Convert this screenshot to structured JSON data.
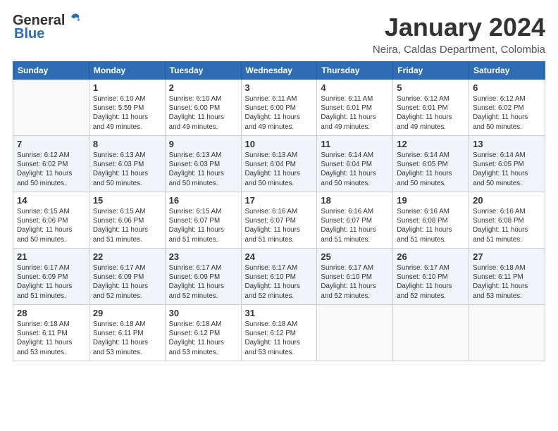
{
  "logo": {
    "general": "General",
    "blue": "Blue"
  },
  "title": "January 2024",
  "location": "Neira, Caldas Department, Colombia",
  "days_of_week": [
    "Sunday",
    "Monday",
    "Tuesday",
    "Wednesday",
    "Thursday",
    "Friday",
    "Saturday"
  ],
  "weeks": [
    [
      {
        "num": "",
        "sunrise": "",
        "sunset": "",
        "daylight": ""
      },
      {
        "num": "1",
        "sunrise": "Sunrise: 6:10 AM",
        "sunset": "Sunset: 5:59 PM",
        "daylight": "Daylight: 11 hours and 49 minutes."
      },
      {
        "num": "2",
        "sunrise": "Sunrise: 6:10 AM",
        "sunset": "Sunset: 6:00 PM",
        "daylight": "Daylight: 11 hours and 49 minutes."
      },
      {
        "num": "3",
        "sunrise": "Sunrise: 6:11 AM",
        "sunset": "Sunset: 6:00 PM",
        "daylight": "Daylight: 11 hours and 49 minutes."
      },
      {
        "num": "4",
        "sunrise": "Sunrise: 6:11 AM",
        "sunset": "Sunset: 6:01 PM",
        "daylight": "Daylight: 11 hours and 49 minutes."
      },
      {
        "num": "5",
        "sunrise": "Sunrise: 6:12 AM",
        "sunset": "Sunset: 6:01 PM",
        "daylight": "Daylight: 11 hours and 49 minutes."
      },
      {
        "num": "6",
        "sunrise": "Sunrise: 6:12 AM",
        "sunset": "Sunset: 6:02 PM",
        "daylight": "Daylight: 11 hours and 50 minutes."
      }
    ],
    [
      {
        "num": "7",
        "sunrise": "Sunrise: 6:12 AM",
        "sunset": "Sunset: 6:02 PM",
        "daylight": "Daylight: 11 hours and 50 minutes."
      },
      {
        "num": "8",
        "sunrise": "Sunrise: 6:13 AM",
        "sunset": "Sunset: 6:03 PM",
        "daylight": "Daylight: 11 hours and 50 minutes."
      },
      {
        "num": "9",
        "sunrise": "Sunrise: 6:13 AM",
        "sunset": "Sunset: 6:03 PM",
        "daylight": "Daylight: 11 hours and 50 minutes."
      },
      {
        "num": "10",
        "sunrise": "Sunrise: 6:13 AM",
        "sunset": "Sunset: 6:04 PM",
        "daylight": "Daylight: 11 hours and 50 minutes."
      },
      {
        "num": "11",
        "sunrise": "Sunrise: 6:14 AM",
        "sunset": "Sunset: 6:04 PM",
        "daylight": "Daylight: 11 hours and 50 minutes."
      },
      {
        "num": "12",
        "sunrise": "Sunrise: 6:14 AM",
        "sunset": "Sunset: 6:05 PM",
        "daylight": "Daylight: 11 hours and 50 minutes."
      },
      {
        "num": "13",
        "sunrise": "Sunrise: 6:14 AM",
        "sunset": "Sunset: 6:05 PM",
        "daylight": "Daylight: 11 hours and 50 minutes."
      }
    ],
    [
      {
        "num": "14",
        "sunrise": "Sunrise: 6:15 AM",
        "sunset": "Sunset: 6:06 PM",
        "daylight": "Daylight: 11 hours and 50 minutes."
      },
      {
        "num": "15",
        "sunrise": "Sunrise: 6:15 AM",
        "sunset": "Sunset: 6:06 PM",
        "daylight": "Daylight: 11 hours and 51 minutes."
      },
      {
        "num": "16",
        "sunrise": "Sunrise: 6:15 AM",
        "sunset": "Sunset: 6:07 PM",
        "daylight": "Daylight: 11 hours and 51 minutes."
      },
      {
        "num": "17",
        "sunrise": "Sunrise: 6:16 AM",
        "sunset": "Sunset: 6:07 PM",
        "daylight": "Daylight: 11 hours and 51 minutes."
      },
      {
        "num": "18",
        "sunrise": "Sunrise: 6:16 AM",
        "sunset": "Sunset: 6:07 PM",
        "daylight": "Daylight: 11 hours and 51 minutes."
      },
      {
        "num": "19",
        "sunrise": "Sunrise: 6:16 AM",
        "sunset": "Sunset: 6:08 PM",
        "daylight": "Daylight: 11 hours and 51 minutes."
      },
      {
        "num": "20",
        "sunrise": "Sunrise: 6:16 AM",
        "sunset": "Sunset: 6:08 PM",
        "daylight": "Daylight: 11 hours and 51 minutes."
      }
    ],
    [
      {
        "num": "21",
        "sunrise": "Sunrise: 6:17 AM",
        "sunset": "Sunset: 6:09 PM",
        "daylight": "Daylight: 11 hours and 51 minutes."
      },
      {
        "num": "22",
        "sunrise": "Sunrise: 6:17 AM",
        "sunset": "Sunset: 6:09 PM",
        "daylight": "Daylight: 11 hours and 52 minutes."
      },
      {
        "num": "23",
        "sunrise": "Sunrise: 6:17 AM",
        "sunset": "Sunset: 6:09 PM",
        "daylight": "Daylight: 11 hours and 52 minutes."
      },
      {
        "num": "24",
        "sunrise": "Sunrise: 6:17 AM",
        "sunset": "Sunset: 6:10 PM",
        "daylight": "Daylight: 11 hours and 52 minutes."
      },
      {
        "num": "25",
        "sunrise": "Sunrise: 6:17 AM",
        "sunset": "Sunset: 6:10 PM",
        "daylight": "Daylight: 11 hours and 52 minutes."
      },
      {
        "num": "26",
        "sunrise": "Sunrise: 6:17 AM",
        "sunset": "Sunset: 6:10 PM",
        "daylight": "Daylight: 11 hours and 52 minutes."
      },
      {
        "num": "27",
        "sunrise": "Sunrise: 6:18 AM",
        "sunset": "Sunset: 6:11 PM",
        "daylight": "Daylight: 11 hours and 53 minutes."
      }
    ],
    [
      {
        "num": "28",
        "sunrise": "Sunrise: 6:18 AM",
        "sunset": "Sunset: 6:11 PM",
        "daylight": "Daylight: 11 hours and 53 minutes."
      },
      {
        "num": "29",
        "sunrise": "Sunrise: 6:18 AM",
        "sunset": "Sunset: 6:11 PM",
        "daylight": "Daylight: 11 hours and 53 minutes."
      },
      {
        "num": "30",
        "sunrise": "Sunrise: 6:18 AM",
        "sunset": "Sunset: 6:12 PM",
        "daylight": "Daylight: 11 hours and 53 minutes."
      },
      {
        "num": "31",
        "sunrise": "Sunrise: 6:18 AM",
        "sunset": "Sunset: 6:12 PM",
        "daylight": "Daylight: 11 hours and 53 minutes."
      },
      {
        "num": "",
        "sunrise": "",
        "sunset": "",
        "daylight": ""
      },
      {
        "num": "",
        "sunrise": "",
        "sunset": "",
        "daylight": ""
      },
      {
        "num": "",
        "sunrise": "",
        "sunset": "",
        "daylight": ""
      }
    ]
  ]
}
